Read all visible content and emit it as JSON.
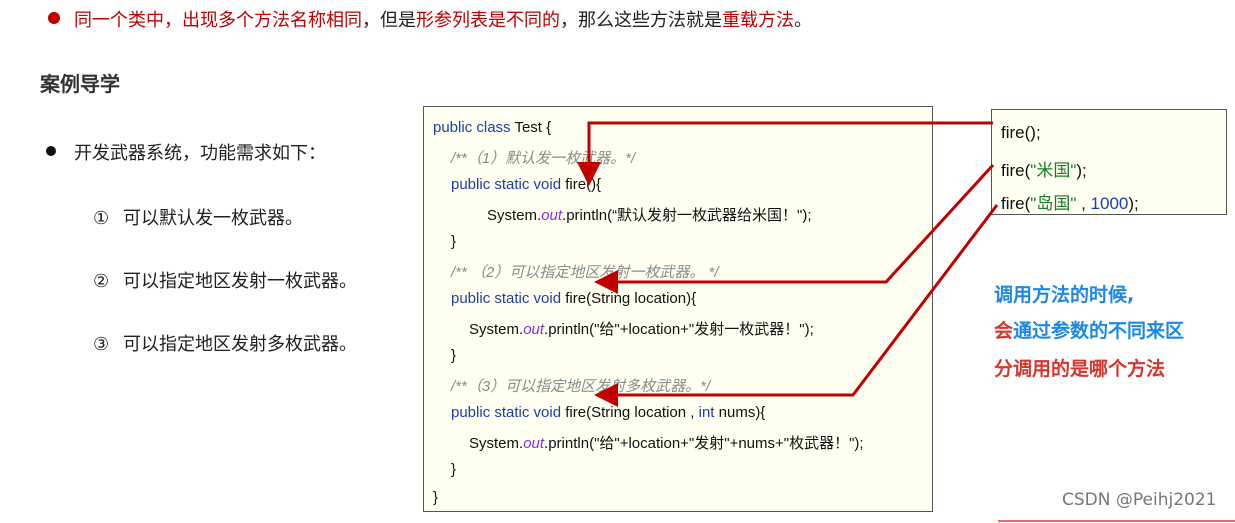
{
  "top_line": {
    "parts": [
      "同一个类中，出现",
      "多个方法名称相同",
      "，但是",
      "形参列表是不同的",
      "，那么这些方法就是",
      "重载方法",
      "。"
    ]
  },
  "section_title": "案例导学",
  "bullet": "开发武器系统，功能需求如下：",
  "requirements": [
    {
      "num": "①",
      "text": "可以默认发一枚武器。"
    },
    {
      "num": "②",
      "text": "可以指定地区发射一枚武器。"
    },
    {
      "num": "③",
      "text": "可以指定地区发射多枚武器。"
    }
  ],
  "code": {
    "l1_kw": "public class",
    "l1_rest": " Test {",
    "l2": "/**（1）默认发一枚武器。*/",
    "l3_kw": "public static void",
    "l3_rest": " fire(){",
    "l4_a": "System.",
    "l4_b": "out",
    "l4_c": ".println(“默认发射一枚武器给米国！\");",
    "l5": "}",
    "l6": "/** （2）可以指定地区发射一枚武器。 */",
    "l7_kw": "public static void",
    "l7_rest": " fire(String location){",
    "l8_a": "System.",
    "l8_b": "out",
    "l8_c": ".println(\"给\"+location+\"发射一枚武器！\");",
    "l9": "}",
    "l10": "/**（3）可以指定地区发射多枚武器。*/",
    "l11_kw": "public static void",
    "l11_mid": " fire(String location , ",
    "l11_kw2": "int",
    "l11_rest": " nums){",
    "l12_a": "System.",
    "l12_b": "out",
    "l12_c": ".println(\"给\"+location+\"发射\"+nums+\"枚武器！\");",
    "l13": "}",
    "l14": "}"
  },
  "calls": {
    "c1": "fire();",
    "c2_a": "fire(",
    "c2_b": "\"米国\"",
    "c2_c": ");",
    "c3_a": "fire(",
    "c3_b": "\"岛国\"",
    "c3_c": " , ",
    "c3_d": "1000",
    "c3_e": ");"
  },
  "note": {
    "l1": "调用方法的时候,",
    "l2_a": "会",
    "l2_b": "通过参数的不同来区",
    "l3_a": "分",
    "l3_b": "调用的是哪个方法"
  },
  "watermark": "CSDN @Peihj2021",
  "colors": {
    "accent_red": "#c00000",
    "keyword_blue": "#1c3fb0",
    "note_blue": "#1e88e5",
    "note_red": "#d9342b"
  }
}
